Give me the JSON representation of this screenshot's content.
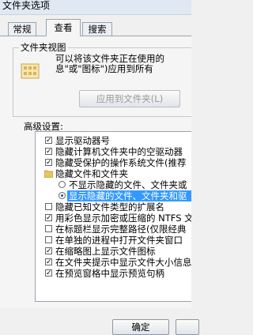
{
  "window": {
    "title": "文件夹选项"
  },
  "tabs": [
    {
      "label": "常规"
    },
    {
      "label": "查看"
    },
    {
      "label": "搜索"
    }
  ],
  "folder_views": {
    "title": "文件夹视图",
    "description_line1": "可以将该文件夹正在使用的",
    "description_line2": "息\"或\"图标\")应用到所有",
    "apply_button": "应用到文件夹(L)"
  },
  "advanced": {
    "label": "高级设置:",
    "items": [
      {
        "type": "checkbox",
        "checked": true,
        "label": "显示驱动器号"
      },
      {
        "type": "checkbox",
        "checked": true,
        "label": "隐藏计算机文件夹中的空驱动器"
      },
      {
        "type": "checkbox",
        "checked": true,
        "label": "隐藏受保护的操作系统文件(推荐"
      },
      {
        "type": "folder",
        "label": "隐藏文件和文件夹"
      },
      {
        "type": "radio",
        "checked": false,
        "label": "不显示隐藏的文件、文件夹或"
      },
      {
        "type": "radio",
        "checked": true,
        "selected": true,
        "label": "显示隐藏的文件、文件夹和驱"
      },
      {
        "type": "checkbox",
        "checked": false,
        "label": "隐藏已知文件类型的扩展名"
      },
      {
        "type": "checkbox",
        "checked": true,
        "label": "用彩色显示加密或压缩的 NTFS 文"
      },
      {
        "type": "checkbox",
        "checked": false,
        "label": "在标题栏显示完整路径(仅限经典"
      },
      {
        "type": "checkbox",
        "checked": false,
        "label": "在单独的进程中打开文件夹窗口"
      },
      {
        "type": "checkbox",
        "checked": true,
        "label": "在缩略图上显示文件图标"
      },
      {
        "type": "checkbox",
        "checked": true,
        "label": "在文件夹提示中显示文件大小信息"
      },
      {
        "type": "checkbox",
        "checked": true,
        "label": "在预览窗格中显示预览句柄"
      }
    ]
  },
  "buttons": {
    "ok": "确定"
  }
}
